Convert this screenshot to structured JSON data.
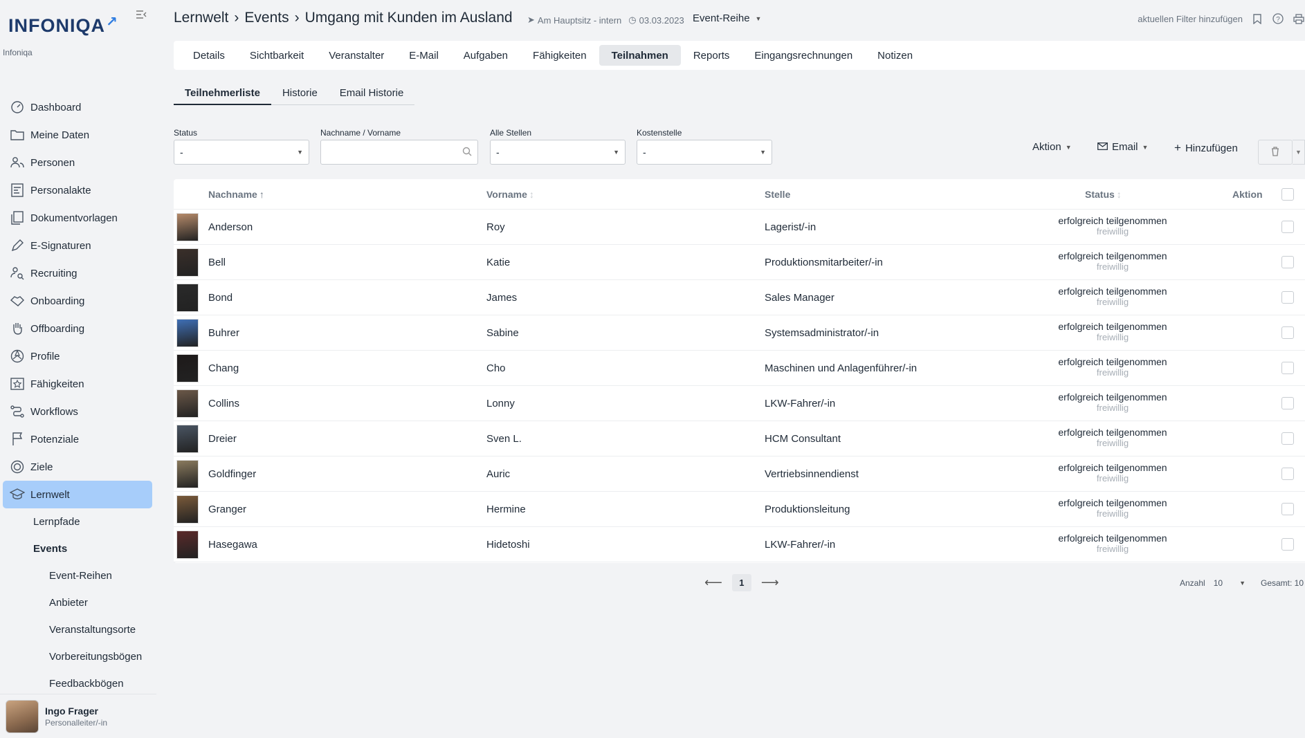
{
  "brand": {
    "logo_text": "INFONIQA",
    "org": "Infoniqa"
  },
  "sidebar": {
    "items": [
      {
        "label": "Dashboard",
        "icon": "dashboard-icon"
      },
      {
        "label": "Meine Daten",
        "icon": "folder-icon"
      },
      {
        "label": "Personen",
        "icon": "people-icon"
      },
      {
        "label": "Personalakte",
        "icon": "file-person-icon"
      },
      {
        "label": "Dokumentvorlagen",
        "icon": "documents-icon"
      },
      {
        "label": "E-Signaturen",
        "icon": "pen-icon"
      },
      {
        "label": "Recruiting",
        "icon": "recruiting-icon"
      },
      {
        "label": "Onboarding",
        "icon": "handshake-icon"
      },
      {
        "label": "Offboarding",
        "icon": "hand-icon"
      },
      {
        "label": "Profile",
        "icon": "profile-icon"
      },
      {
        "label": "Fähigkeiten",
        "icon": "star-icon"
      },
      {
        "label": "Workflows",
        "icon": "workflow-icon"
      },
      {
        "label": "Potenziale",
        "icon": "flag-icon"
      },
      {
        "label": "Ziele",
        "icon": "target-icon"
      },
      {
        "label": "Lernwelt",
        "icon": "graduation-cap-icon"
      }
    ],
    "sub_items": [
      "Lernpfade",
      "Events"
    ],
    "sub_sub_items": [
      "Event-Reihen",
      "Anbieter",
      "Veranstaltungsorte",
      "Vorbereitungsbögen",
      "Feedbackbögen"
    ],
    "user": {
      "name": "Ingo Frager",
      "role": "Personalleiter/-in"
    }
  },
  "header": {
    "crumb1": "Lernwelt",
    "crumb2": "Events",
    "crumb3": "Umgang mit Kunden im Ausland",
    "location": "Am Hauptsitz - intern",
    "date": "03.03.2023",
    "event_type": "Event-Reihe",
    "filter_link": "aktuellen Filter hinzufügen"
  },
  "tabs": [
    "Details",
    "Sichtbarkeit",
    "Veranstalter",
    "E-Mail",
    "Aufgaben",
    "Fähigkeiten",
    "Teilnahmen",
    "Reports",
    "Eingangsrechnungen",
    "Notizen"
  ],
  "active_tab": "Teilnahmen",
  "subtabs": [
    "Teilnehmerliste",
    "Historie",
    "Email Historie"
  ],
  "filters": {
    "status": {
      "label": "Status",
      "value": "-"
    },
    "name": {
      "label": "Nachname / Vorname",
      "value": ""
    },
    "stellen": {
      "label": "Alle Stellen",
      "value": "-"
    },
    "kostenstelle": {
      "label": "Kostenstelle",
      "value": "-"
    }
  },
  "toolbar": {
    "aktion": "Aktion",
    "email": "Email",
    "add": "Hinzufügen"
  },
  "table": {
    "headers": {
      "nachname": "Nachname",
      "vorname": "Vorname",
      "stelle": "Stelle",
      "status": "Status",
      "aktion": "Aktion"
    },
    "rows": [
      {
        "nachname": "Anderson",
        "vorname": "Roy",
        "stelle": "Lagerist/-in",
        "status": "erfolgreich teilgenommen",
        "sub": "freiwillig",
        "avatar_color": "#b58a6a"
      },
      {
        "nachname": "Bell",
        "vorname": "Katie",
        "stelle": "Produktionsmitarbeiter/-in",
        "status": "erfolgreich teilgenommen",
        "sub": "freiwillig",
        "avatar_color": "#3a2f2a"
      },
      {
        "nachname": "Bond",
        "vorname": "James",
        "stelle": "Sales Manager",
        "status": "erfolgreich teilgenommen",
        "sub": "freiwillig",
        "avatar_color": "#2a2a2a"
      },
      {
        "nachname": "Buhrer",
        "vorname": "Sabine",
        "stelle": "Systemsadministrator/-in",
        "status": "erfolgreich teilgenommen",
        "sub": "freiwillig",
        "avatar_color": "#3f6fb5"
      },
      {
        "nachname": "Chang",
        "vorname": "Cho",
        "stelle": "Maschinen und Anlagenführer/-in",
        "status": "erfolgreich teilgenommen",
        "sub": "freiwillig",
        "avatar_color": "#1e1a1a"
      },
      {
        "nachname": "Collins",
        "vorname": "Lonny",
        "stelle": "LKW-Fahrer/-in",
        "status": "erfolgreich teilgenommen",
        "sub": "freiwillig",
        "avatar_color": "#6b5848"
      },
      {
        "nachname": "Dreier",
        "vorname": "Sven L.",
        "stelle": "HCM Consultant",
        "status": "erfolgreich teilgenommen",
        "sub": "freiwillig",
        "avatar_color": "#4a5563"
      },
      {
        "nachname": "Goldfinger",
        "vorname": "Auric",
        "stelle": "Vertriebsinnendienst",
        "status": "erfolgreich teilgenommen",
        "sub": "freiwillig",
        "avatar_color": "#8a7a5e"
      },
      {
        "nachname": "Granger",
        "vorname": "Hermine",
        "stelle": "Produktionsleitung",
        "status": "erfolgreich teilgenommen",
        "sub": "freiwillig",
        "avatar_color": "#7a5a3a"
      },
      {
        "nachname": "Hasegawa",
        "vorname": "Hidetoshi",
        "stelle": "LKW-Fahrer/-in",
        "status": "erfolgreich teilgenommen",
        "sub": "freiwillig",
        "avatar_color": "#5a2a2a"
      }
    ]
  },
  "pagination": {
    "page": "1",
    "count_label": "Anzahl",
    "count_value": "10",
    "total": "Gesamt: 10"
  },
  "colors": {
    "accent": "#a7cdfa",
    "brand": "#1d3a6b",
    "logo_arrow": "#2f7de1"
  }
}
